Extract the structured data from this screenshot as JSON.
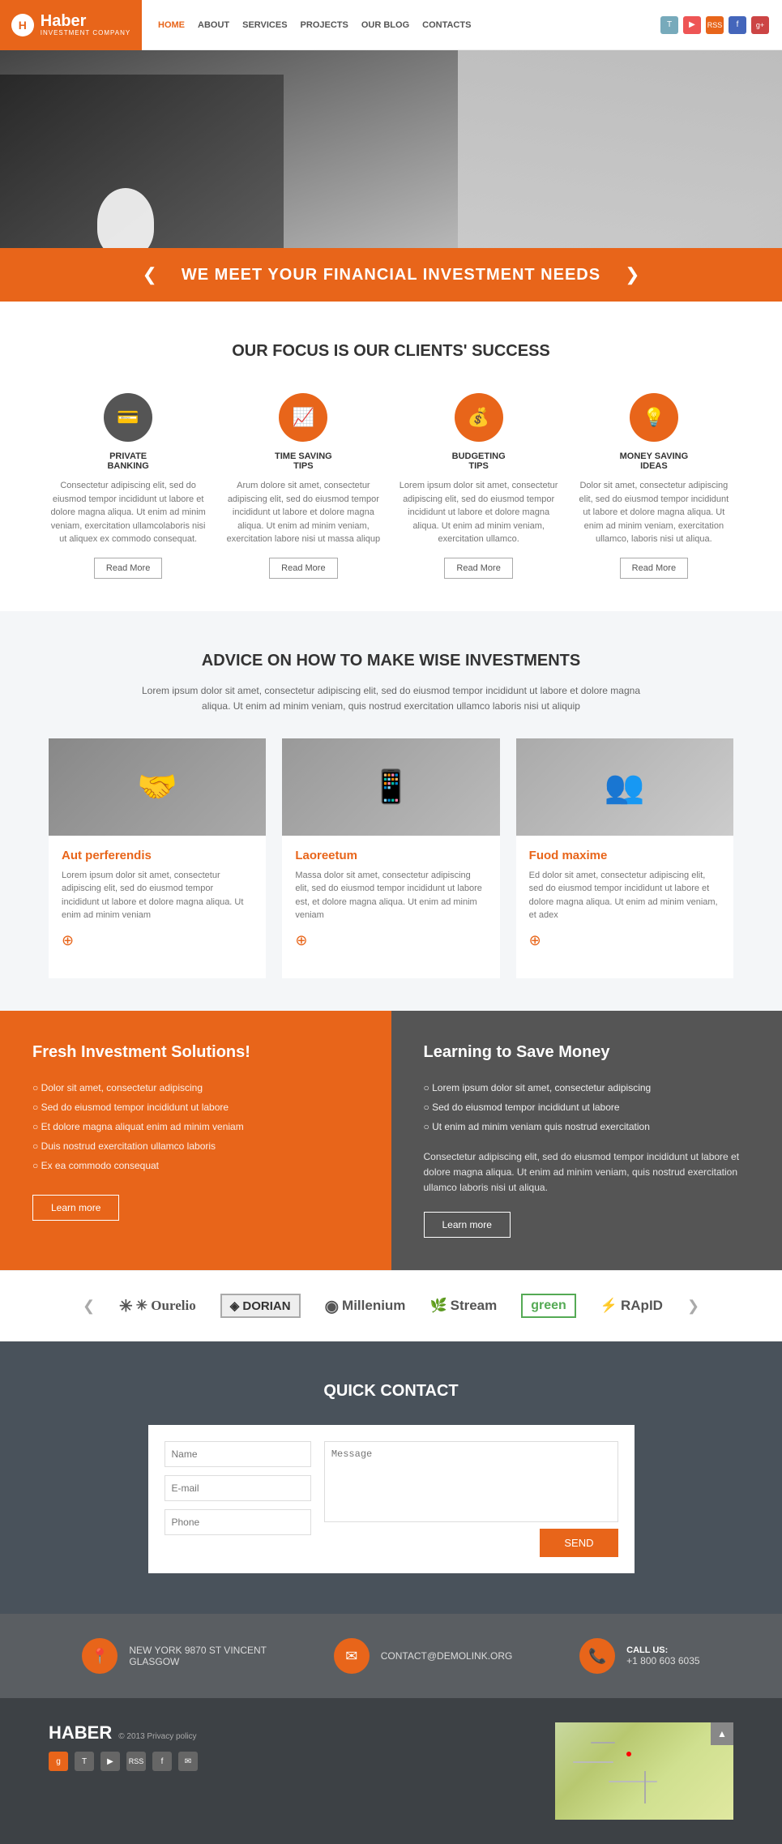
{
  "header": {
    "logo": {
      "icon": "H",
      "name": "Haber",
      "sub": "INVESTMENT COMPANY"
    },
    "nav": {
      "items": [
        {
          "label": "HOME",
          "active": true
        },
        {
          "label": "ABOUT",
          "active": false
        },
        {
          "label": "SERVICES",
          "active": false
        },
        {
          "label": "PROJECTS",
          "active": false
        },
        {
          "label": "OUR BLOG",
          "active": false
        },
        {
          "label": "CONTACTS",
          "active": false
        }
      ]
    },
    "social": [
      "T",
      "▶",
      "RSS",
      "f",
      "g+"
    ]
  },
  "hero": {
    "prev_arrow": "❮",
    "next_arrow": "❯",
    "banner_text": "WE MEET YOUR FINANCIAL INVESTMENT NEEDS"
  },
  "focus": {
    "title": "OUR FOCUS IS OUR CLIENTS' SUCCESS",
    "features": [
      {
        "icon": "💳",
        "title": "PRIVATE\nBANKING",
        "desc": "Consectetur adipiscing elit, sed do eiusmod tempor incididunt ut labore et dolore magna aliqua. Ut enim ad minim veniam, exercitation ullamcolaboris nisi ut aliquex ex commodo consequat.",
        "btn": "Read More"
      },
      {
        "icon": "📈",
        "title": "TIME SAVING\nTIPS",
        "desc": "Arum dolore sit amet, consectetur adipiscing elit, sed do eiusmod tempor incididunt ut labore et dolore magna aliqua. Ut enim ad minim veniam, exercitation labore nisi ut massa aliqup",
        "btn": "Read More"
      },
      {
        "icon": "💰",
        "title": "BUDGETING\nTIPS",
        "desc": "Lorem ipsum dolor sit amet, consectetur adipiscing elit, sed do eiusmod tempor incididunt ut labore et dolore magna aliqua. Ut enim ad minim veniam, exercitation ullamco.",
        "btn": "Read More"
      },
      {
        "icon": "💡",
        "title": "MONEY SAVING\nIDEAS",
        "desc": "Dolor sit amet, consectetur adipiscing elit, sed do eiusmod tempor incididunt ut labore et dolore magna aliqua. Ut enim ad minim veniam, exercitation ullamco, laboris nisi ut aliqua.",
        "btn": "Read More"
      }
    ]
  },
  "advice": {
    "title": "ADVICE ON HOW TO MAKE WISE INVESTMENTS",
    "desc": "Lorem ipsum dolor sit amet, consectetur adipiscing elit, sed do eiusmod tempor incididunt ut labore et dolore magna aliqua. Ut enim ad minim veniam, quis nostrud exercitation ullamco laboris nisi ut aliquip",
    "cards": [
      {
        "img_emoji": "🤝",
        "img_bg": "#888",
        "title": "Aut perferendis",
        "desc": "Lorem ipsum dolor sit amet, consectetur adipiscing elit, sed do eiusmod tempor incididunt ut labore et dolore magna aliqua. Ut enim ad minim veniam"
      },
      {
        "img_emoji": "📱",
        "img_bg": "#999",
        "title": "Laoreetum",
        "desc": "Massa dolor sit amet, consectetur adipiscing elit, sed do eiusmod tempor incididunt ut labore est, et dolore magna aliqua. Ut enim ad minim veniam"
      },
      {
        "img_emoji": "👥",
        "img_bg": "#aaa",
        "title": "Fuod maxime",
        "desc": "Ed dolor sit amet, consectetur adipiscing elit, sed do eiusmod tempor incididunt ut labore et dolore magna aliqua. Ut enim ad minim veniam, et adex"
      }
    ]
  },
  "solutions": {
    "left": {
      "title": "Fresh Investment Solutions!",
      "items": [
        "Dolor sit amet, consectetur adipiscing",
        "Sed do eiusmod tempor incididunt ut labore",
        "Et dolore magna aliquat enim ad minim veniam",
        "Duis nostrud exercitation ullamco laboris",
        "Ex ea commodo consequat"
      ],
      "btn": "Learn more"
    },
    "right": {
      "title": "Learning to Save Money",
      "items": [
        "Lorem ipsum dolor sit amet, consectetur adipiscing",
        "Sed do eiusmod tempor incididunt ut labore",
        "Ut enim ad minim veniam quis nostrud exercitation"
      ],
      "desc": "Consectetur adipiscing elit, sed do eiusmod tempor incididunt ut labore et dolore magna aliqua. Ut enim ad minim veniam, quis nostrud exercitation ullamco laboris nisi ut aliqua.",
      "btn": "Learn more"
    }
  },
  "logos": {
    "prev": "❮",
    "next": "❯",
    "items": [
      {
        "label": "✳ Ourelio",
        "special": false
      },
      {
        "label": "◈ DORIAN",
        "special": true
      },
      {
        "label": "◉ Millenium",
        "special": false
      },
      {
        "label": "🌿 Stream",
        "special": false
      },
      {
        "label": "green",
        "special": true
      },
      {
        "label": "⚡ RApID",
        "special": false
      }
    ]
  },
  "contact": {
    "title": "QUICK CONTACT",
    "form": {
      "name_placeholder": "Name",
      "email_placeholder": "E-mail",
      "phone_placeholder": "Phone",
      "message_placeholder": "Message",
      "send_btn": "SEND"
    }
  },
  "info_row": {
    "items": [
      {
        "icon": "📍",
        "text": "NEW YORK 9870 ST VINCENT\nGLASGOW"
      },
      {
        "icon": "✉",
        "text": "CONTACT@DEMOLINK.ORG"
      },
      {
        "icon": "📞",
        "label": "CALL US:",
        "text": "+1 800 603 6035"
      }
    ]
  },
  "footer": {
    "brand": "HABER",
    "copy": "© 2013  Privacy policy",
    "social_icons": [
      "g",
      "T",
      "▶",
      "RSS",
      "f",
      "✉"
    ],
    "scroll_top": "▲"
  }
}
